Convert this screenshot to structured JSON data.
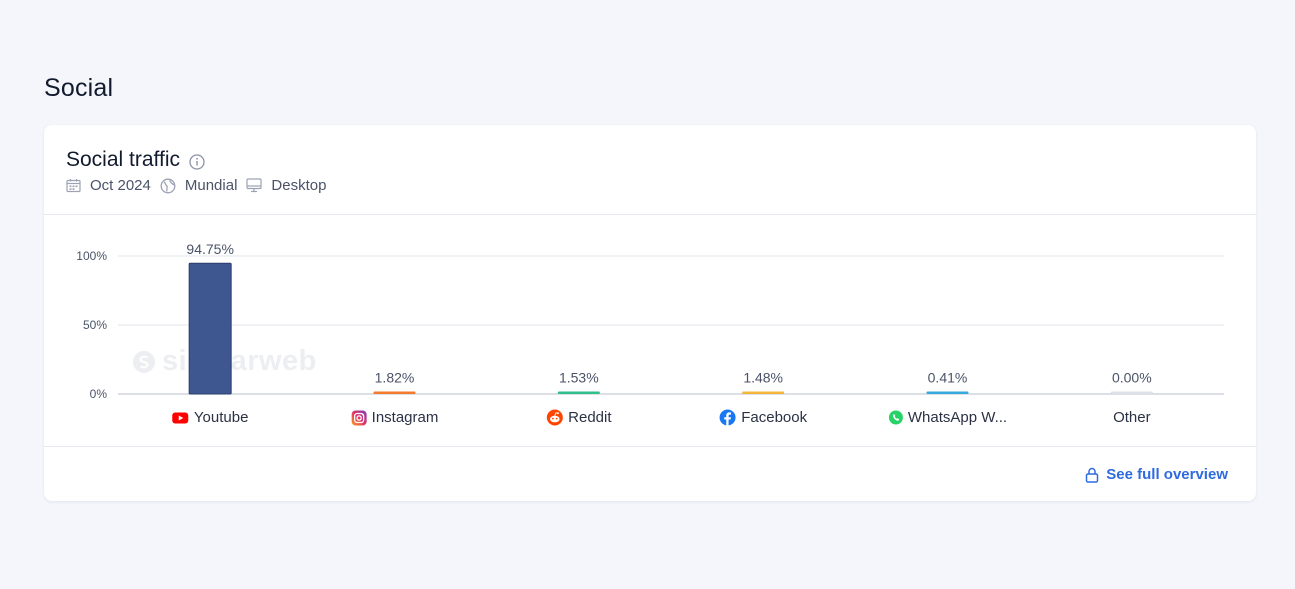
{
  "section": {
    "title": "Social"
  },
  "card": {
    "title": "Social traffic",
    "meta": {
      "date": "Oct 2024",
      "region": "Mundial",
      "device": "Desktop"
    },
    "footer": {
      "link_label": "See full overview"
    },
    "watermark": "similarweb"
  },
  "colors": {
    "accent": "#2f6be0",
    "bar_primary": "#3f5791"
  },
  "chart_data": {
    "type": "bar",
    "categories": [
      "Youtube",
      "Instagram",
      "Reddit",
      "Facebook",
      "WhatsApp W...",
      "Other"
    ],
    "values": [
      94.75,
      1.82,
      1.53,
      1.48,
      0.41,
      0.0
    ],
    "data_labels": [
      "94.75%",
      "1.82%",
      "1.53%",
      "1.48%",
      "0.41%",
      "0.00%"
    ],
    "bar_colors": [
      "#3f5791",
      "#f37a2f",
      "#2fbf8a",
      "#f4b73c",
      "#38a9dd",
      "#dde1e8"
    ],
    "icons": [
      "youtube-icon",
      "instagram-icon",
      "reddit-icon",
      "facebook-icon",
      "whatsapp-icon",
      ""
    ],
    "yticks": [
      "0%",
      "50%",
      "100%"
    ],
    "ytick_values": [
      0,
      50,
      100
    ],
    "ylim": [
      0,
      100
    ],
    "grid": true
  }
}
